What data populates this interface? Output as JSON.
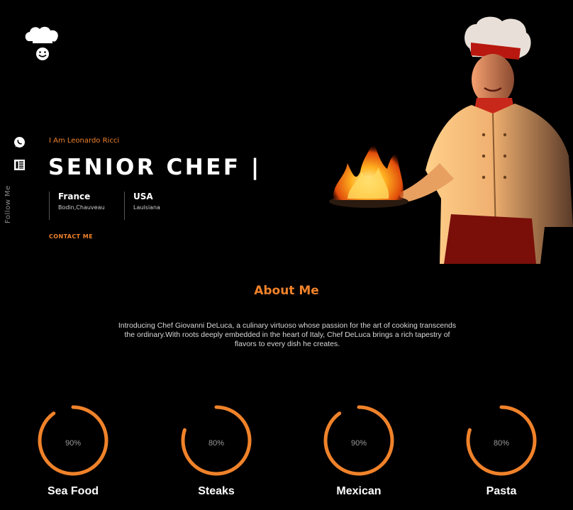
{
  "brand": {
    "logo_icon": "chef-hat-smiley-icon"
  },
  "social": {
    "icons": [
      "whatsapp-icon",
      "news-icon"
    ],
    "follow_label": "Follow Me"
  },
  "hero": {
    "intro": "I Am Leonardo Ricci",
    "title": "SENIOR CHEF |",
    "locations": [
      {
        "country": "France",
        "city": "Bodin,Chauveau"
      },
      {
        "country": "USA",
        "city": "Lauisiana"
      }
    ],
    "contact_label": "CONTACT ME"
  },
  "about": {
    "title": "About Me",
    "text": "Introducing Chef Giovanni DeLuca, a culinary virtuoso whose passion for the art of cooking transcends the ordinary.With roots deeply embedded in the heart of Italy, Chef DeLuca brings a rich tapestry of flavors to every dish he creates."
  },
  "skills": [
    {
      "name": "Sea Food",
      "percent_label": "90%",
      "value": 0.9
    },
    {
      "name": "Steaks",
      "percent_label": "80%",
      "value": 0.8
    },
    {
      "name": "Mexican",
      "percent_label": "90%",
      "value": 0.9
    },
    {
      "name": "Pasta",
      "percent_label": "80%",
      "value": 0.8
    }
  ],
  "colors": {
    "accent": "#f0822a",
    "background": "#000000",
    "text": "#ffffff"
  }
}
